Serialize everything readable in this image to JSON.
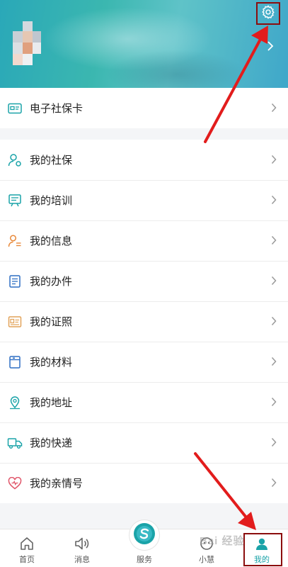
{
  "colors": {
    "accent": "#1aa3a8",
    "annotation_red": "#e21c1c",
    "box_red": "#8b0d0d"
  },
  "header": {
    "settings_icon": "gear-icon",
    "chevron_icon": "chevron-right-icon"
  },
  "card_section": {
    "items": [
      {
        "label": "电子社保卡",
        "icon": "card-icon"
      }
    ]
  },
  "menu": {
    "items": [
      {
        "label": "我的社保",
        "icon": "person-badge-icon"
      },
      {
        "label": "我的培训",
        "icon": "training-board-icon"
      },
      {
        "label": "我的信息",
        "icon": "person-list-icon"
      },
      {
        "label": "我的办件",
        "icon": "document-icon"
      },
      {
        "label": "我的证照",
        "icon": "id-card-icon"
      },
      {
        "label": "我的材料",
        "icon": "folder-icon"
      },
      {
        "label": "我的地址",
        "icon": "location-icon"
      },
      {
        "label": "我的快递",
        "icon": "truck-icon"
      },
      {
        "label": "我的亲情号",
        "icon": "heart-icon"
      }
    ]
  },
  "tabbar": {
    "tabs": [
      {
        "label": "首页",
        "icon": "home-icon"
      },
      {
        "label": "消息",
        "icon": "speaker-icon"
      },
      {
        "label": "服务",
        "icon": "service-logo-icon"
      },
      {
        "label": "小慧",
        "icon": "assistant-icon"
      },
      {
        "label": "我的",
        "icon": "profile-icon",
        "active": true
      }
    ]
  },
  "watermark": {
    "text": "Bai 经验"
  }
}
